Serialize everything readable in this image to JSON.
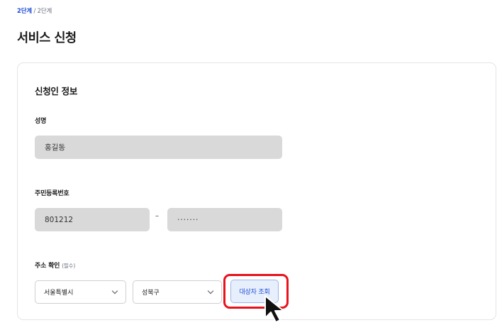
{
  "breadcrumb": {
    "current": "2단계",
    "separator": "/",
    "total": "2단계"
  },
  "page_title": "서비스 신청",
  "card": {
    "section_title": "신청인 정보",
    "name": {
      "label": "성명",
      "value": "홍길동"
    },
    "rrn": {
      "label": "주민등록번호",
      "front": "801212",
      "separator": "–",
      "back": "·······"
    },
    "address": {
      "label": "주소 확인",
      "required_note": "(필수)",
      "city_select": "서울특별시",
      "district_select": "성북구",
      "lookup_button": "대상자 조회"
    }
  },
  "colors": {
    "accent": "#1d4ed8",
    "highlight": "#e8121c",
    "field_bg": "#d9d9d9"
  }
}
